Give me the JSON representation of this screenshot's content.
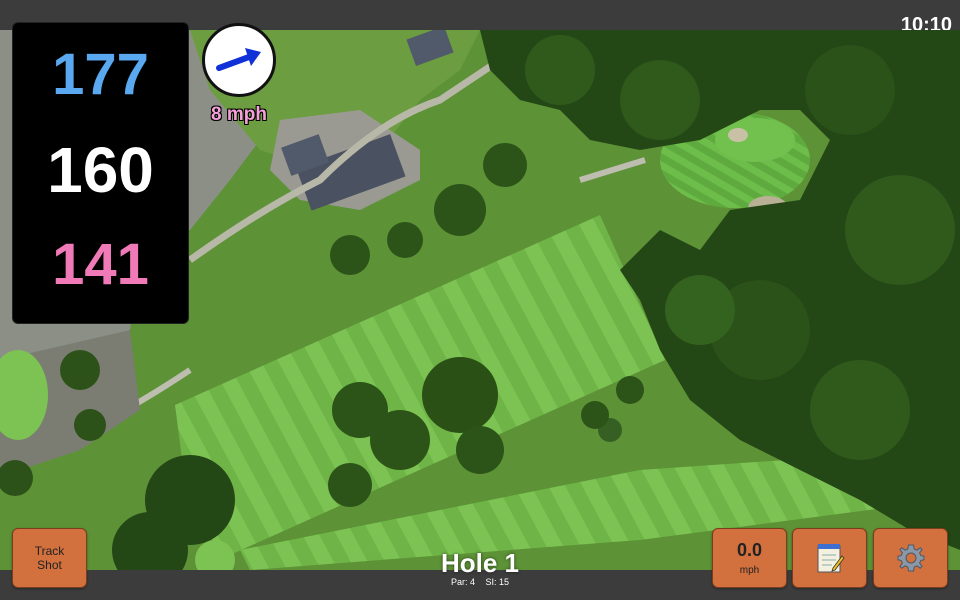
{
  "status_bar": {
    "time": "10:10"
  },
  "distances": {
    "back": "177",
    "middle": "160",
    "front": "141",
    "colors": {
      "back": "#5aa8f0",
      "middle": "#ffffff",
      "front": "#f07ab8"
    }
  },
  "wind": {
    "speed": "8 mph",
    "arrow_color": "#1030d8",
    "speed_color": "#f5a0d8"
  },
  "hole": {
    "title": "Hole 1",
    "par": "Par: 4",
    "stroke_index": "SI: 15"
  },
  "buttons": {
    "track_shot_line1": "Track",
    "track_shot_line2": "Shot",
    "speed_value": "0.0",
    "speed_unit": "mph",
    "notes_icon": "notepad-icon",
    "settings_icon": "gear-icon",
    "color": "#d2703e"
  }
}
